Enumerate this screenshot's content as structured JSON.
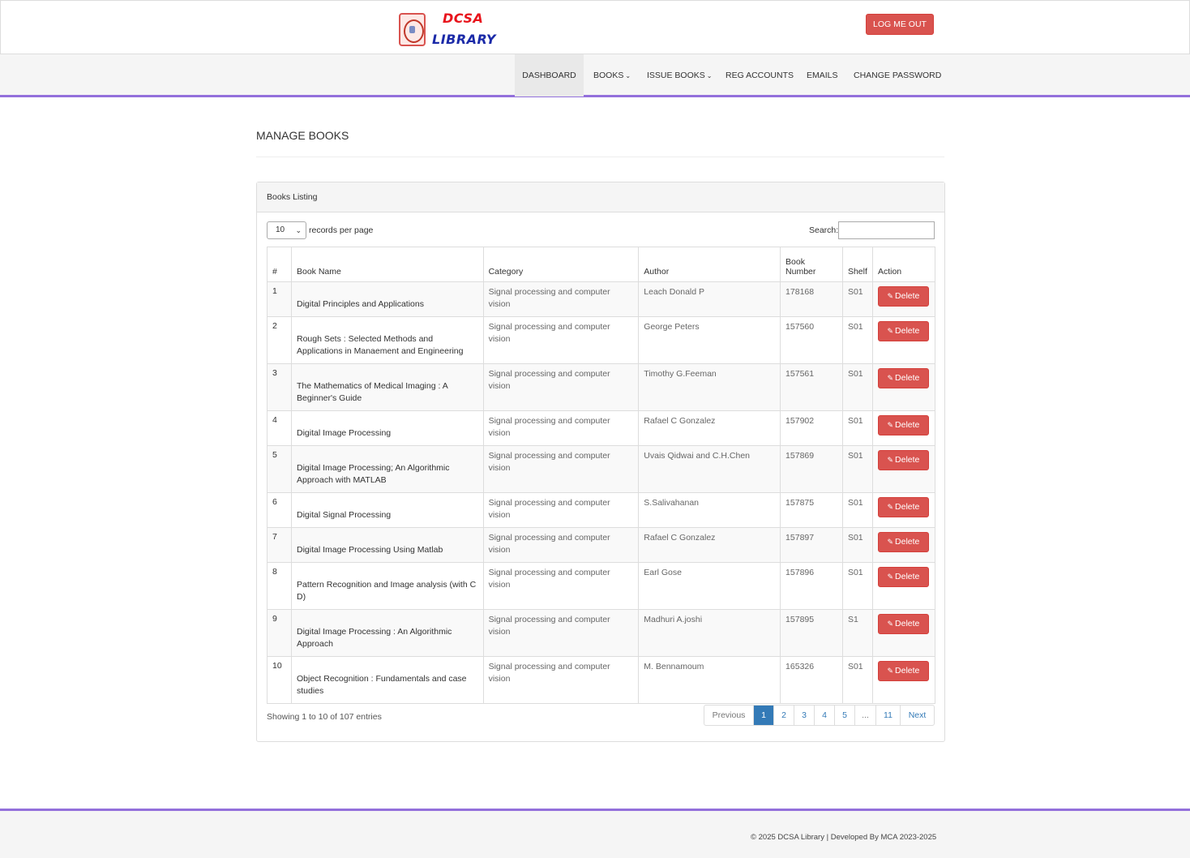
{
  "brand": {
    "line1": "DCSA",
    "line2": "LIBRARY"
  },
  "header": {
    "logout_label": "LOG ME OUT"
  },
  "nav": {
    "dashboard": "DASHBOARD",
    "books": "BOOKS",
    "issue_books": "ISSUE BOOKS",
    "reg_accounts": "REG ACCOUNTS",
    "emails": "EMAILS",
    "change_password": "CHANGE PASSWORD",
    "caret_icon": "chevron-down-icon"
  },
  "page": {
    "title": "MANAGE BOOKS"
  },
  "panel": {
    "heading": "Books Listing",
    "length_value": "10",
    "length_label": "records per page",
    "search_label": "Search:"
  },
  "table": {
    "columns": {
      "num": "#",
      "name": "Book Name",
      "category": "Category",
      "author": "Author",
      "number_line1": "Book",
      "number_line2": "Number",
      "shelf": "Shelf",
      "action": "Action"
    },
    "delete_label": "Delete",
    "rows": [
      {
        "num": "1",
        "name": "Digital Principles and Applications",
        "category": "Signal processing and computer vision",
        "author": "Leach Donald P",
        "number": "178168",
        "shelf": "S01"
      },
      {
        "num": "2",
        "name": "Rough Sets : Selected Methods and Applications in Manaement and Engineering",
        "category": "Signal processing and computer vision",
        "author": "George Peters",
        "number": "157560",
        "shelf": "S01"
      },
      {
        "num": "3",
        "name": "The Mathematics of Medical Imaging : A Beginner's Guide",
        "category": "Signal processing and computer vision",
        "author": "Timothy G.Feeman",
        "number": "157561",
        "shelf": "S01"
      },
      {
        "num": "4",
        "name": "Digital Image Processing",
        "category": "Signal processing and computer vision",
        "author": "Rafael C Gonzalez",
        "number": "157902",
        "shelf": "S01"
      },
      {
        "num": "5",
        "name": "Digital Image Processing; An Algorithmic Approach with MATLAB",
        "category": "Signal processing and computer vision",
        "author": "Uvais Qidwai and C.H.Chen",
        "number": "157869",
        "shelf": "S01"
      },
      {
        "num": "6",
        "name": "Digital Signal Processing",
        "category": "Signal processing and computer vision",
        "author": "S.Salivahanan",
        "number": "157875",
        "shelf": "S01"
      },
      {
        "num": "7",
        "name": "Digital Image Processing Using Matlab",
        "category": "Signal processing and computer vision",
        "author": "Rafael C Gonzalez",
        "number": "157897",
        "shelf": "S01"
      },
      {
        "num": "8",
        "name": "Pattern Recognition and Image analysis (with C D)",
        "category": "Signal processing and computer vision",
        "author": "Earl Gose",
        "number": "157896",
        "shelf": "S01"
      },
      {
        "num": "9",
        "name": "Digital Image Processing : An Algorithmic Approach",
        "category": "Signal processing and computer vision",
        "author": "Madhuri A.joshi",
        "number": "157895",
        "shelf": "S1"
      },
      {
        "num": "10",
        "name": "Object Recognition : Fundamentals and case studies",
        "category": "Signal processing and computer vision",
        "author": "M. Bennamoum",
        "number": "165326",
        "shelf": "S01"
      }
    ]
  },
  "pagination": {
    "info": "Showing 1 to 10 of 107 entries",
    "previous": "Previous",
    "pages": [
      "1",
      "2",
      "3",
      "4",
      "5",
      "...",
      "11"
    ],
    "active_page": "1",
    "next": "Next"
  },
  "footer": {
    "text": "© 2025 DCSA Library | Developed By MCA 2023-2025"
  },
  "colors": {
    "accent": "#9370db",
    "danger": "#d9534f",
    "primary": "#337ab7"
  }
}
